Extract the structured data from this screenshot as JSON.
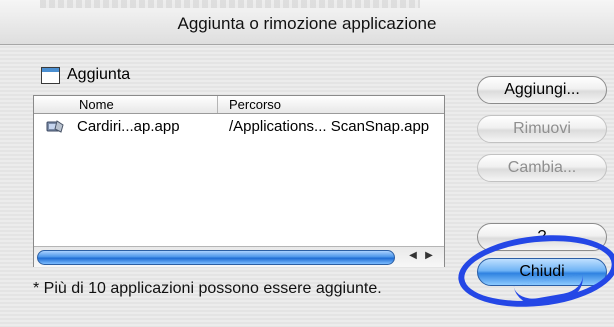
{
  "window": {
    "title": "Aggiunta o rimozione applicazione"
  },
  "section": {
    "label": "Aggiunta"
  },
  "list": {
    "columns": [
      "Nome",
      "Percorso"
    ],
    "rows": [
      {
        "name": "Cardiri...ap.app",
        "path": "/Applications... ScanSnap.app"
      }
    ]
  },
  "buttons": {
    "add": "Aggiungi...",
    "remove": "Rimuovi",
    "change": "Cambia...",
    "help": "?",
    "close": "Chiudi"
  },
  "footnote": "* Più di 10 applicazioni possono essere aggiunte.",
  "colors": {
    "annotation": "#2447e6",
    "default_button": "#2f82e1"
  }
}
